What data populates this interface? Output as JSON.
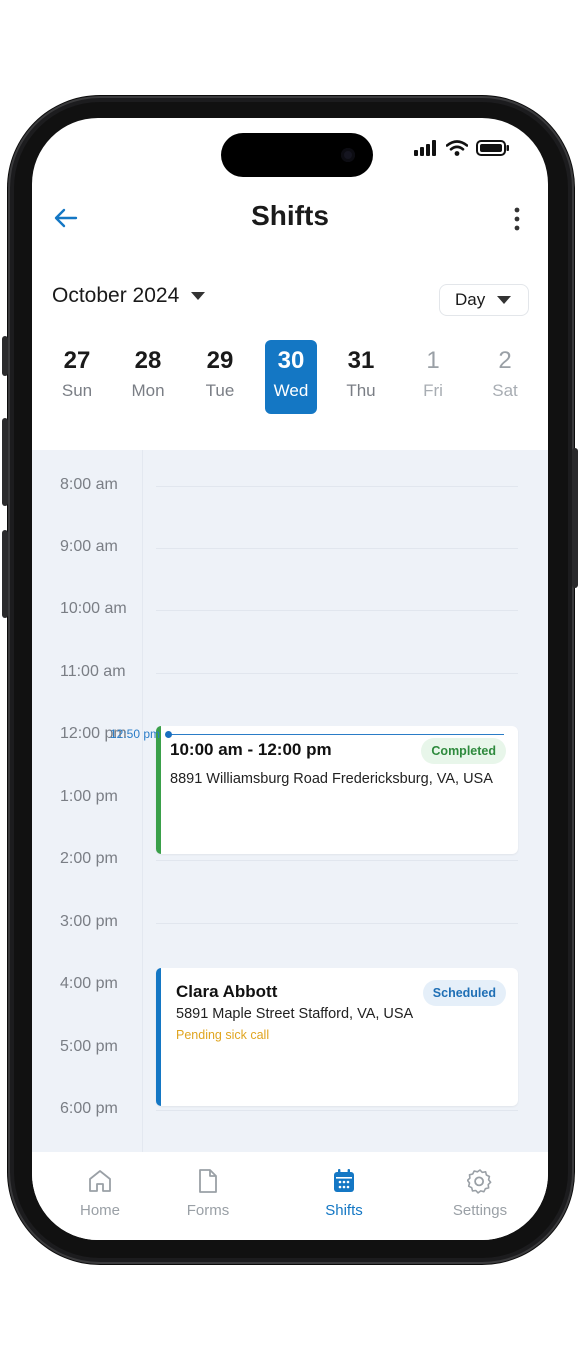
{
  "header": {
    "title": "Shifts"
  },
  "calendar": {
    "month_label": "October 2024",
    "view": "Day",
    "week": [
      {
        "num": "27",
        "name": "Sun"
      },
      {
        "num": "28",
        "name": "Mon"
      },
      {
        "num": "29",
        "name": "Tue"
      },
      {
        "num": "30",
        "name": "Wed"
      },
      {
        "num": "31",
        "name": "Thu"
      },
      {
        "num": "1",
        "name": "Fri"
      },
      {
        "num": "2",
        "name": "Sat"
      }
    ],
    "hours": [
      "8:00 am",
      "9:00 am",
      "10:00 am",
      "11:00 am",
      "12:00 pm",
      "1:00 pm",
      "2:00 pm",
      "3:00 pm",
      "4:00 pm",
      "5:00 pm",
      "6:00 pm"
    ],
    "now_label": "12:50 pm",
    "events": [
      {
        "title": "10:00 am - 12:00 pm",
        "address": "8891 Williamsburg Road Fredericksburg, VA, USA",
        "status": "Completed",
        "note": ""
      },
      {
        "title": "Clara Abbott",
        "address": "5891 Maple Street Stafford, VA, USA",
        "status": "Scheduled",
        "note": "Pending sick call"
      }
    ]
  },
  "tabs": [
    {
      "label": "Home",
      "icon": "home-icon"
    },
    {
      "label": "Forms",
      "icon": "document-icon"
    },
    {
      "label": "Shifts",
      "icon": "calendar-icon"
    },
    {
      "label": "Settings",
      "icon": "gear-icon"
    }
  ],
  "colors": {
    "accent": "#1477c4",
    "completed": "#3aa04a",
    "scheduled": "#1477c4",
    "warning": "#e0a520",
    "calendar_bg": "#eef2f8"
  }
}
